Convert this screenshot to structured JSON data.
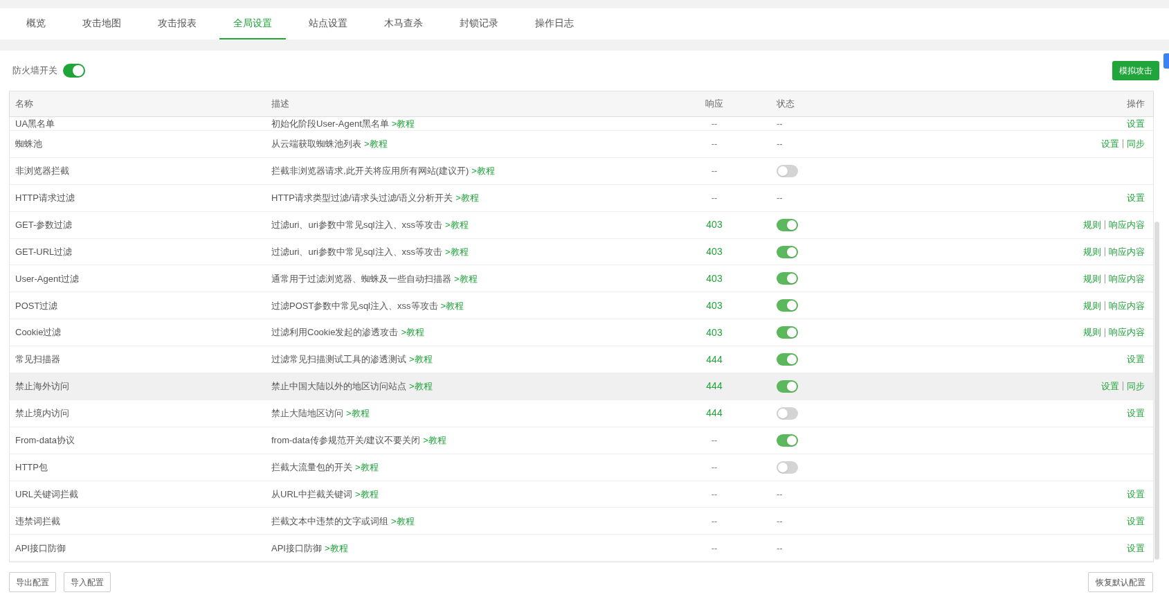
{
  "tabs": [
    {
      "label": "概览",
      "selected": false
    },
    {
      "label": "攻击地图",
      "selected": false
    },
    {
      "label": "攻击报表",
      "selected": false
    },
    {
      "label": "全局设置",
      "selected": true
    },
    {
      "label": "站点设置",
      "selected": false
    },
    {
      "label": "木马查杀",
      "selected": false
    },
    {
      "label": "封锁记录",
      "selected": false
    },
    {
      "label": "操作日志",
      "selected": false
    }
  ],
  "firewall": {
    "label": "防火墙开关",
    "on": true
  },
  "simulate_button": "模拟攻击",
  "table": {
    "columns": [
      "名称",
      "描述",
      "响应",
      "状态",
      "操作"
    ],
    "rows": [
      {
        "name": "UA黑名单",
        "description": "初始化阶段User-Agent黑名单",
        "link": ">教程",
        "response": {
          "text": "--",
          "highlight": false
        },
        "status": {
          "kind": "text",
          "text": "--"
        },
        "actions": [
          "设置"
        ],
        "highlighted": false
      },
      {
        "name": "蜘蛛池",
        "description": "从云端获取蜘蛛池列表",
        "link": ">教程",
        "response": {
          "text": "--",
          "highlight": false
        },
        "status": {
          "kind": "text",
          "text": "--"
        },
        "actions": [
          "设置",
          "同步"
        ],
        "highlighted": false
      },
      {
        "name": "非浏览器拦截",
        "description": "拦截非浏览器请求,此开关将应用所有网站(建议开)",
        "link": ">教程",
        "response": {
          "text": "--",
          "highlight": false
        },
        "status": {
          "kind": "toggle",
          "on": false
        },
        "actions": [],
        "highlighted": false
      },
      {
        "name": "HTTP请求过滤",
        "description": "HTTP请求类型过滤/请求头过滤/语义分析开关",
        "link": ">教程",
        "response": {
          "text": "--",
          "highlight": false
        },
        "status": {
          "kind": "text",
          "text": "--"
        },
        "actions": [
          "设置"
        ],
        "highlighted": false
      },
      {
        "name": "GET-参数过滤",
        "description": "过滤uri、uri参数中常见sql注入、xss等攻击",
        "link": ">教程",
        "response": {
          "text": "403",
          "highlight": true
        },
        "status": {
          "kind": "toggle",
          "on": true
        },
        "actions": [
          "规则",
          "响应内容"
        ],
        "highlighted": false
      },
      {
        "name": "GET-URL过滤",
        "description": "过滤uri、uri参数中常见sql注入、xss等攻击",
        "link": ">教程",
        "response": {
          "text": "403",
          "highlight": true
        },
        "status": {
          "kind": "toggle",
          "on": true
        },
        "actions": [
          "规则",
          "响应内容"
        ],
        "highlighted": false
      },
      {
        "name": "User-Agent过滤",
        "description": "通常用于过滤浏览器、蜘蛛及一些自动扫描器",
        "link": ">教程",
        "response": {
          "text": "403",
          "highlight": true
        },
        "status": {
          "kind": "toggle",
          "on": true
        },
        "actions": [
          "规则",
          "响应内容"
        ],
        "highlighted": false
      },
      {
        "name": "POST过滤",
        "description": "过滤POST参数中常见sql注入、xss等攻击",
        "link": ">教程",
        "response": {
          "text": "403",
          "highlight": true
        },
        "status": {
          "kind": "toggle",
          "on": true
        },
        "actions": [
          "规则",
          "响应内容"
        ],
        "highlighted": false
      },
      {
        "name": "Cookie过滤",
        "description": "过滤利用Cookie发起的渗透攻击",
        "link": ">教程",
        "response": {
          "text": "403",
          "highlight": true
        },
        "status": {
          "kind": "toggle",
          "on": true
        },
        "actions": [
          "规则",
          "响应内容"
        ],
        "highlighted": false
      },
      {
        "name": "常见扫描器",
        "description": "过滤常见扫描测试工具的渗透测试",
        "link": ">教程",
        "response": {
          "text": "444",
          "highlight": true
        },
        "status": {
          "kind": "toggle",
          "on": true
        },
        "actions": [
          "设置"
        ],
        "highlighted": false
      },
      {
        "name": "禁止海外访问",
        "description": "禁止中国大陆以外的地区访问站点",
        "link": ">教程",
        "response": {
          "text": "444",
          "highlight": true
        },
        "status": {
          "kind": "toggle",
          "on": true
        },
        "actions": [
          "设置",
          "同步"
        ],
        "highlighted": true
      },
      {
        "name": "禁止境内访问",
        "description": "禁止大陆地区访问",
        "link": ">教程",
        "response": {
          "text": "444",
          "highlight": true
        },
        "status": {
          "kind": "toggle",
          "on": false
        },
        "actions": [
          "设置"
        ],
        "highlighted": false
      },
      {
        "name": "From-data协议",
        "description": "from-data传参规范开关/建议不要关闭",
        "link": ">教程",
        "response": {
          "text": "--",
          "highlight": false
        },
        "status": {
          "kind": "toggle",
          "on": true
        },
        "actions": [],
        "highlighted": false
      },
      {
        "name": "HTTP包",
        "description": "拦截大流量包的开关",
        "link": ">教程",
        "response": {
          "text": "--",
          "highlight": false
        },
        "status": {
          "kind": "toggle",
          "on": false
        },
        "actions": [],
        "highlighted": false
      },
      {
        "name": "URL关键词拦截",
        "description": "从URL中拦截关键词",
        "link": ">教程",
        "response": {
          "text": "--",
          "highlight": false
        },
        "status": {
          "kind": "text",
          "text": "--"
        },
        "actions": [
          "设置"
        ],
        "highlighted": false
      },
      {
        "name": "违禁词拦截",
        "description": "拦截文本中违禁的文字或词组",
        "link": ">教程",
        "response": {
          "text": "--",
          "highlight": false
        },
        "status": {
          "kind": "text",
          "text": "--"
        },
        "actions": [
          "设置"
        ],
        "highlighted": false
      },
      {
        "name": "API接口防御",
        "description": "API接口防御",
        "link": ">教程",
        "response": {
          "text": "--",
          "highlight": false
        },
        "status": {
          "kind": "text",
          "text": "--"
        },
        "actions": [
          "设置"
        ],
        "highlighted": false
      }
    ]
  },
  "footer": {
    "left_buttons": [
      "导出配置",
      "导入配置"
    ],
    "right_button": "恢复默认配置"
  }
}
